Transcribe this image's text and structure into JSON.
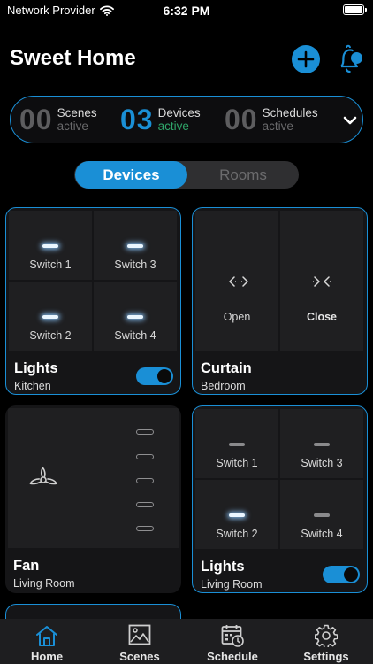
{
  "status_bar": {
    "carrier": "Network Provider",
    "time": "6:32 PM"
  },
  "header": {
    "title": "Sweet Home"
  },
  "summary": {
    "scenes": {
      "count": "00",
      "label": "Scenes",
      "sub": "active"
    },
    "devices": {
      "count": "03",
      "label": "Devices",
      "sub": "active"
    },
    "schedules": {
      "count": "00",
      "label": "Schedules",
      "sub": "active"
    }
  },
  "segmented": {
    "devices": "Devices",
    "rooms": "Rooms"
  },
  "cards": {
    "lights_kitchen": {
      "title": "Lights",
      "room": "Kitchen",
      "toggle_on": true,
      "switches": [
        {
          "label": "Switch 1",
          "on": true
        },
        {
          "label": "Switch 3",
          "on": true
        },
        {
          "label": "Switch 2",
          "on": true
        },
        {
          "label": "Switch 4",
          "on": true
        }
      ]
    },
    "curtain_bedroom": {
      "title": "Curtain",
      "room": "Bedroom",
      "open_label": "Open",
      "close_label": "Close"
    },
    "fan_living": {
      "title": "Fan",
      "room": "Living Room",
      "speed_levels": 5
    },
    "lights_living": {
      "title": "Lights",
      "room": "Living Room",
      "toggle_on": true,
      "switches": [
        {
          "label": "Switch 1",
          "on": false
        },
        {
          "label": "Switch 3",
          "on": false
        },
        {
          "label": "Switch 2",
          "on": true
        },
        {
          "label": "Switch 4",
          "on": false
        }
      ]
    }
  },
  "tabbar": {
    "home": "Home",
    "scenes": "Scenes",
    "schedule": "Schedule",
    "settings": "Settings"
  },
  "colors": {
    "accent": "#1a8fd6",
    "active_green": "#2fa66a",
    "background": "#000000"
  }
}
